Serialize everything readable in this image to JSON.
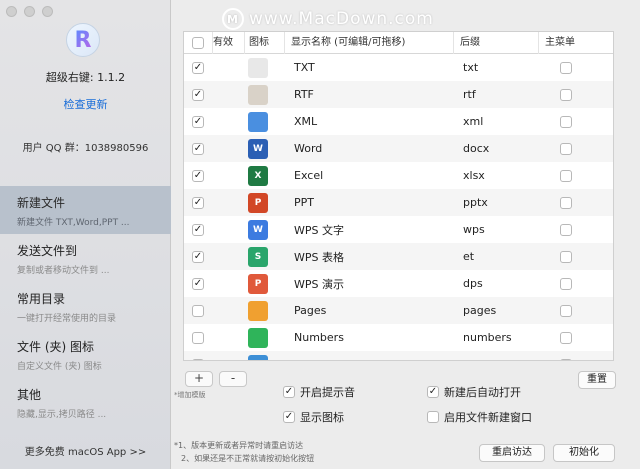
{
  "sidebar": {
    "app_logo_letter": "R",
    "version": "超级右键: 1.1.2",
    "check_update": "检查更新",
    "qq_group": "用户 QQ 群：1038980596",
    "nav": [
      {
        "title": "新建文件",
        "subtitle": "新建文件 TXT,Word,PPT ...",
        "active": true
      },
      {
        "title": "发送文件到",
        "subtitle": "复制或者移动文件到 ...",
        "active": false
      },
      {
        "title": "常用目录",
        "subtitle": "一键打开经常使用的目录",
        "active": false
      },
      {
        "title": "文件 (夹) 图标",
        "subtitle": "自定义文件 (夹) 图标",
        "active": false
      },
      {
        "title": "其他",
        "subtitle": "隐藏,显示,拷贝路径 ...",
        "active": false
      }
    ],
    "more_apps": "更多免费 macOS App >>"
  },
  "watermark": {
    "logo": "M",
    "text": "www.MacDown.com"
  },
  "table": {
    "headers": {
      "enabled": "有效",
      "icon": "图标",
      "name": "显示名称 (可编辑/可拖移)",
      "suffix": "后缀",
      "main_menu": "主菜单"
    },
    "rows": [
      {
        "enabled": true,
        "icon": "txt-file-icon",
        "icon_glyph": "",
        "icon_color": "#e8e8e8",
        "name": "TXT",
        "suffix": "txt",
        "main": false
      },
      {
        "enabled": true,
        "icon": "rtf-file-icon",
        "icon_glyph": "",
        "icon_color": "#d9d2c8",
        "name": "RTF",
        "suffix": "rtf",
        "main": false
      },
      {
        "enabled": true,
        "icon": "xml-file-icon",
        "icon_glyph": "",
        "icon_color": "#4a8fe0",
        "name": "XML",
        "suffix": "xml",
        "main": false
      },
      {
        "enabled": true,
        "icon": "word-icon",
        "icon_glyph": "W",
        "icon_color": "#2b5fb4",
        "name": "Word",
        "suffix": "docx",
        "main": false
      },
      {
        "enabled": true,
        "icon": "excel-icon",
        "icon_glyph": "X",
        "icon_color": "#1f7a43",
        "name": "Excel",
        "suffix": "xlsx",
        "main": false
      },
      {
        "enabled": true,
        "icon": "powerpoint-icon",
        "icon_glyph": "P",
        "icon_color": "#d24726",
        "name": "PPT",
        "suffix": "pptx",
        "main": false
      },
      {
        "enabled": true,
        "icon": "wps-writer-icon",
        "icon_glyph": "W",
        "icon_color": "#3c7be0",
        "name": "WPS 文字",
        "suffix": "wps",
        "main": false
      },
      {
        "enabled": true,
        "icon": "wps-sheet-icon",
        "icon_glyph": "S",
        "icon_color": "#2aa56b",
        "name": "WPS 表格",
        "suffix": "et",
        "main": false
      },
      {
        "enabled": true,
        "icon": "wps-slide-icon",
        "icon_glyph": "P",
        "icon_color": "#e0593b",
        "name": "WPS 演示",
        "suffix": "dps",
        "main": false
      },
      {
        "enabled": false,
        "icon": "pages-icon",
        "icon_glyph": "",
        "icon_color": "#f0a030",
        "name": "Pages",
        "suffix": "pages",
        "main": false
      },
      {
        "enabled": false,
        "icon": "numbers-icon",
        "icon_glyph": "",
        "icon_color": "#2fb45a",
        "name": "Numbers",
        "suffix": "numbers",
        "main": false
      },
      {
        "enabled": false,
        "icon": "keynote-icon",
        "icon_glyph": "",
        "icon_color": "#3d8fd6",
        "name": "",
        "suffix": "",
        "main": false
      }
    ]
  },
  "controls": {
    "add": "+",
    "remove": "-",
    "add_template": "*增加模版",
    "reset": "重置",
    "options": [
      {
        "label": "开启提示音",
        "checked": true
      },
      {
        "label": "显示图标",
        "checked": true
      },
      {
        "label": "新建后自动打开",
        "checked": true
      },
      {
        "label": "启用文件新建窗口",
        "checked": false
      }
    ],
    "restart_button": "重启访达",
    "init_button": "初始化",
    "note1": "*1、版本更新或者异常时请重启访达",
    "note2": "2、如果还是不正常就请按初始化按钮"
  }
}
